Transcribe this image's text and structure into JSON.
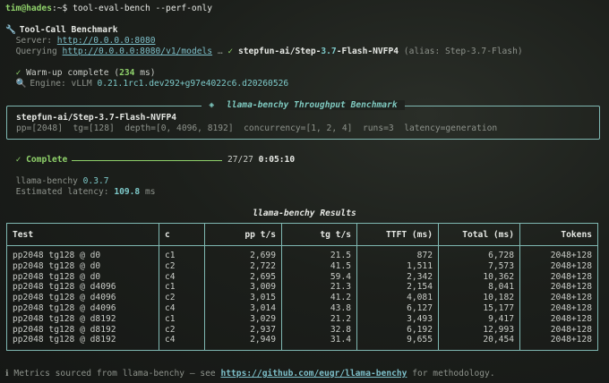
{
  "prompt": {
    "user": "tim@hades",
    "path": ":~$",
    "command": " tool-eval-bench --perf-only"
  },
  "header": {
    "icon": "wrench-icon",
    "title": "Tool-Call Benchmark",
    "server_label": "Server: ",
    "server_url": "http://0.0.0.0:8080",
    "querying_label": "Querying ",
    "querying_url": "http://0.0.0.0:8080/v1/models",
    "querying_sep": " … ",
    "check": "✓",
    "model_prefix": "stepfun-ai/Step-",
    "model_version": "3.7",
    "model_suffix": "-Flash-NVFP4",
    "alias": " (alias: Step-3.7-Flash)"
  },
  "warmup": {
    "check": "✓",
    "text": "Warm-up complete (",
    "ms": "234",
    "ms_unit": " ms)",
    "engine_icon": "magnifier-icon",
    "engine_label": "Engine: vLLM ",
    "engine_version": "0.21.1rc1.dev292+g97e4022c6.d20260526"
  },
  "throughput_box": {
    "title": "llama-benchy Throughput Benchmark",
    "title_icon": "diamond-icon",
    "model": "stepfun-ai/Step-3.7-Flash-NVFP4",
    "params": "pp=[2048]  tg=[128]  depth=[0, 4096, 8192]  concurrency=[1, 2, 4]  runs=3  latency=generation"
  },
  "complete": {
    "check": "✓",
    "label": "Complete",
    "progress": 1.0,
    "count": "27/27",
    "elapsed": "0:05:10"
  },
  "benchy": {
    "name": "llama-benchy ",
    "version": "0.3.7",
    "latency_label": "Estimated latency: ",
    "latency_value": "109.8",
    "latency_unit": " ms"
  },
  "results": {
    "title": "llama-benchy Results",
    "columns": [
      "Test",
      "c",
      "pp t/s",
      "tg t/s",
      "TTFT (ms)",
      "Total (ms)",
      "Tokens"
    ],
    "rows": [
      [
        "pp2048 tg128 @ d0",
        "c1",
        "2,699",
        "21.5",
        "872",
        "6,728",
        "2048+128"
      ],
      [
        "pp2048 tg128 @ d0",
        "c2",
        "2,722",
        "41.5",
        "1,511",
        "7,573",
        "2048+128"
      ],
      [
        "pp2048 tg128 @ d0",
        "c4",
        "2,695",
        "59.4",
        "2,342",
        "10,362",
        "2048+128"
      ],
      [
        "pp2048 tg128 @ d4096",
        "c1",
        "3,009",
        "21.3",
        "2,154",
        "8,041",
        "2048+128"
      ],
      [
        "pp2048 tg128 @ d4096",
        "c2",
        "3,015",
        "41.2",
        "4,081",
        "10,182",
        "2048+128"
      ],
      [
        "pp2048 tg128 @ d4096",
        "c4",
        "3,014",
        "43.8",
        "6,127",
        "15,177",
        "2048+128"
      ],
      [
        "pp2048 tg128 @ d8192",
        "c1",
        "3,029",
        "21.2",
        "3,493",
        "9,417",
        "2048+128"
      ],
      [
        "pp2048 tg128 @ d8192",
        "c2",
        "2,937",
        "32.8",
        "6,192",
        "12,993",
        "2048+128"
      ],
      [
        "pp2048 tg128 @ d8192",
        "c4",
        "2,949",
        "31.4",
        "9,655",
        "20,454",
        "2048+128"
      ]
    ]
  },
  "footer": {
    "icon": "info-icon",
    "text": " Metrics sourced from llama-benchy — see ",
    "url": "https://github.com/eugr/llama-benchy",
    "tail": " for methodology."
  }
}
